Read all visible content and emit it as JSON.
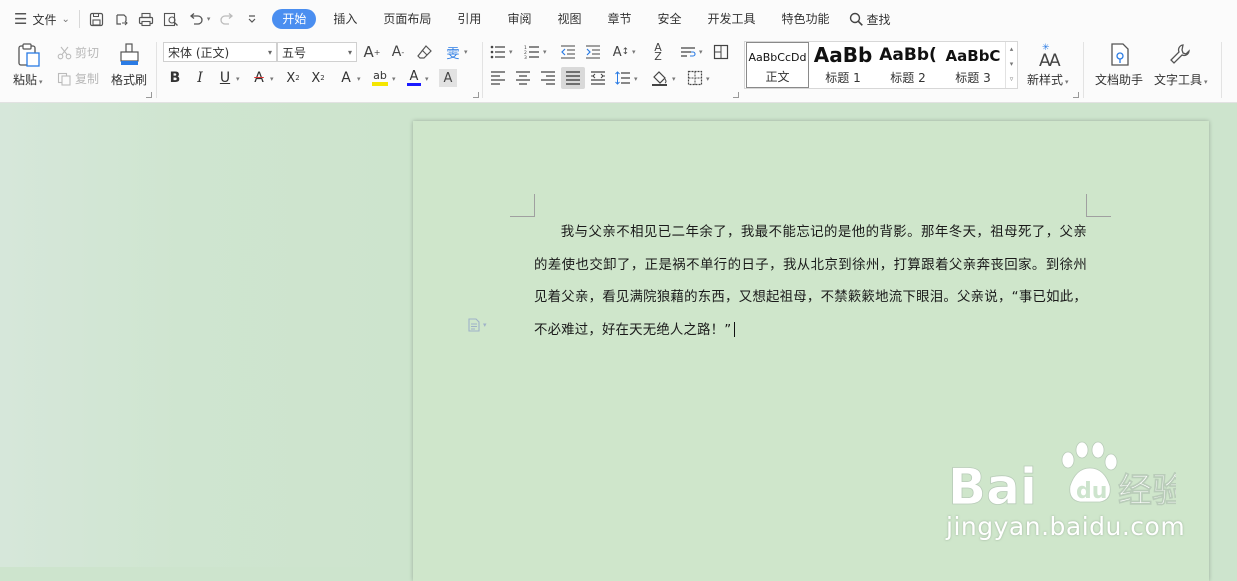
{
  "menubar": {
    "file_label": "文件",
    "tabs": [
      {
        "label": "开始",
        "active": true
      },
      {
        "label": "插入"
      },
      {
        "label": "页面布局"
      },
      {
        "label": "引用"
      },
      {
        "label": "审阅"
      },
      {
        "label": "视图"
      },
      {
        "label": "章节"
      },
      {
        "label": "安全"
      },
      {
        "label": "开发工具"
      },
      {
        "label": "特色功能"
      }
    ],
    "search_label": "查找"
  },
  "ribbon": {
    "paste_label": "粘贴",
    "cut_label": "剪切",
    "copy_label": "复制",
    "format_painter_label": "格式刷",
    "font_name": "宋体 (正文)",
    "font_size": "五号",
    "styles": [
      {
        "sample": "AaBbCcDd",
        "name": "正文"
      },
      {
        "sample": "AaBb",
        "name": "标题 1"
      },
      {
        "sample": "AaBb(",
        "name": "标题 2"
      },
      {
        "sample": "AaBbC",
        "name": "标题 3"
      }
    ],
    "new_style_label": "新样式",
    "doc_assistant_label": "文档助手",
    "text_tools_label": "文字工具",
    "highlight_color": "#f5e600",
    "font_color": "#1a1aff",
    "accent": "#4a8ef0"
  },
  "document": {
    "paragraph": "我与父亲不相见已二年余了，我最不能忘记的是他的背影。那年冬天，祖母死了，父亲的差使也交卸了，正是祸不单行的日子，我从北京到徐州，打算跟着父亲奔丧回家。到徐州见着父亲，看见满院狼藉的东西，又想起祖母，不禁簌簌地流下眼泪。父亲说，“事已如此，不必难过，好在天无绝人之路！”"
  },
  "watermark": {
    "brand": "Bai du 经验",
    "url": "jingyan.baidu.com"
  }
}
